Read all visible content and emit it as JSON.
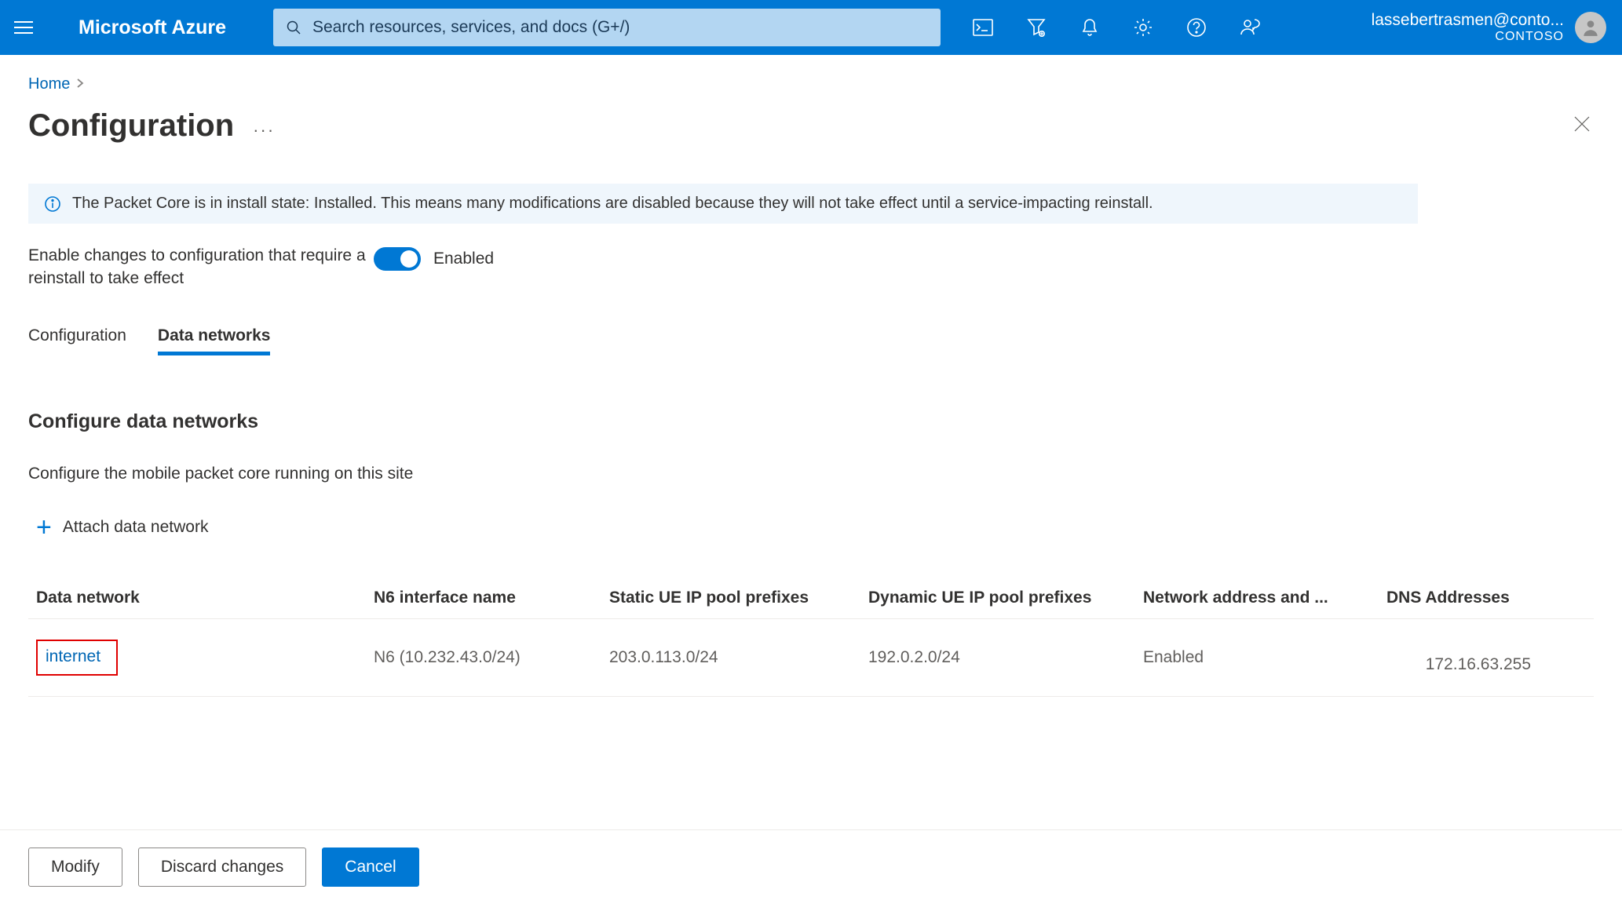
{
  "header": {
    "brand": "Microsoft Azure",
    "search_placeholder": "Search resources, services, and docs (G+/)",
    "user_email": "lassebertrasmen@conto...",
    "tenant": "CONTOSO"
  },
  "breadcrumb": {
    "home": "Home"
  },
  "page": {
    "title": "Configuration",
    "info_banner": "The Packet Core is in install state: Installed. This means many modifications are disabled because they will not take effect until a service-impacting reinstall.",
    "toggle_label": "Enable changes to configuration that require a reinstall to take effect",
    "toggle_state": "Enabled"
  },
  "tabs": {
    "configuration": "Configuration",
    "data_networks": "Data networks"
  },
  "section": {
    "heading": "Configure data networks",
    "sub": "Configure the mobile packet core running on this site",
    "attach_label": "Attach data network"
  },
  "table": {
    "columns": {
      "data_network": "Data network",
      "n6": "N6 interface name",
      "static_prefixes": "Static UE IP pool prefixes",
      "dynamic_prefixes": "Dynamic UE IP pool prefixes",
      "nat": "Network address and ...",
      "dns": "DNS Addresses"
    },
    "rows": [
      {
        "data_network": "internet",
        "n6": "N6 (10.232.43.0/24)",
        "static_prefixes": "203.0.113.0/24",
        "dynamic_prefixes": "192.0.2.0/24",
        "nat": "Enabled",
        "dns": "172.16.63.255"
      }
    ]
  },
  "footer": {
    "modify": "Modify",
    "discard": "Discard changes",
    "cancel": "Cancel"
  }
}
